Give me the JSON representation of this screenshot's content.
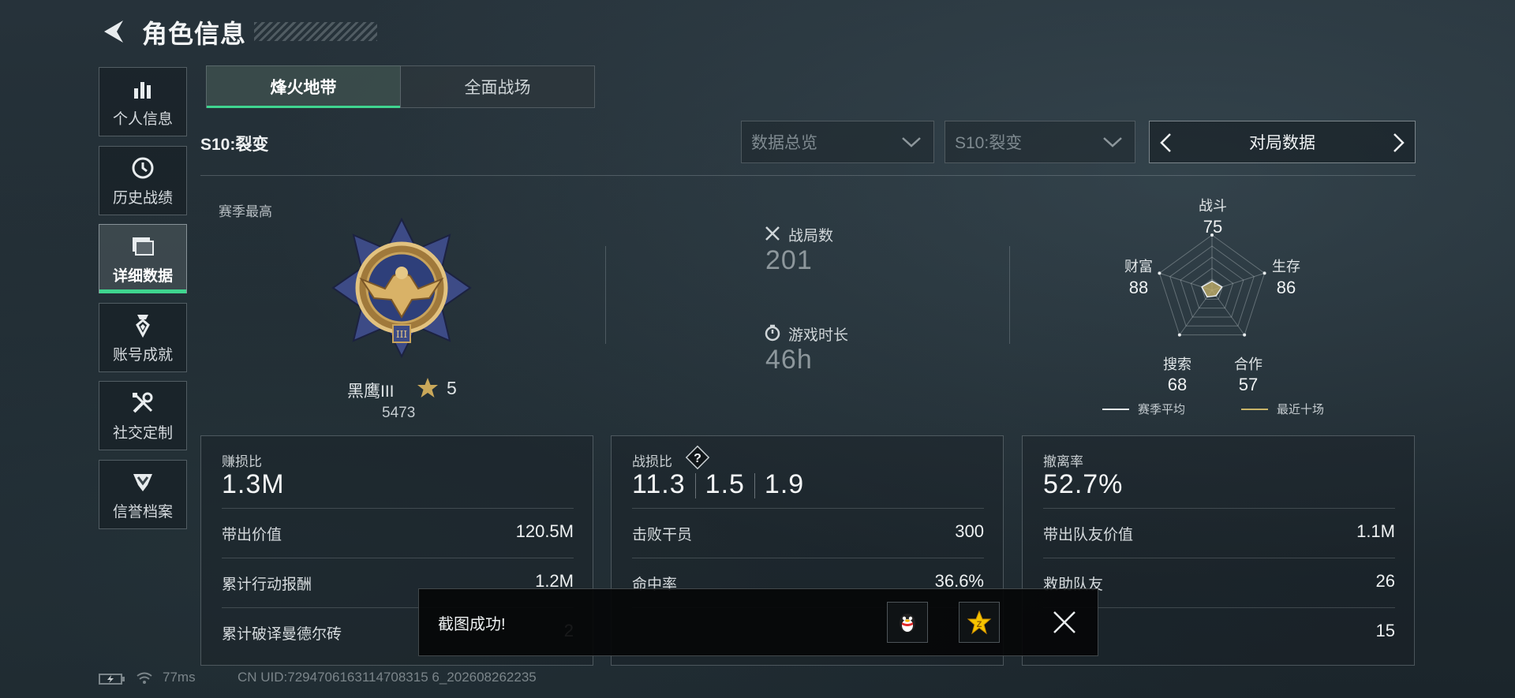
{
  "header": {
    "title": "角色信息"
  },
  "sidebar": {
    "items": [
      {
        "label": "个人信息",
        "icon": "bar-chart-icon",
        "active": false
      },
      {
        "label": "历史战绩",
        "icon": "clock-history-icon",
        "active": false
      },
      {
        "label": "详细数据",
        "icon": "folder-icon",
        "active": true
      },
      {
        "label": "账号成就",
        "icon": "medal-icon",
        "active": false
      },
      {
        "label": "社交定制",
        "icon": "tools-icon",
        "active": false
      },
      {
        "label": "信誉档案",
        "icon": "shield-badge-icon",
        "active": false
      }
    ]
  },
  "mode_tabs": [
    {
      "label": "烽火地带",
      "active": true
    },
    {
      "label": "全面战场",
      "active": false
    }
  ],
  "season_title": "S10:裂变",
  "filters": {
    "dropdown_1": "数据总览",
    "dropdown_2": "S10:裂变",
    "selector": "对局数据"
  },
  "rank": {
    "caption": "赛季最高",
    "name": "黑鹰III",
    "stars": "5",
    "score": "5473",
    "badge_icon": "eagle-medal-icon"
  },
  "summary": {
    "matches_label": "战局数",
    "matches_value": "201",
    "playtime_label": "游戏时长",
    "playtime_value": "46h"
  },
  "radar": {
    "axes": [
      {
        "label": "战斗",
        "value": "75"
      },
      {
        "label": "生存",
        "value": "86"
      },
      {
        "label": "合作",
        "value": "57"
      },
      {
        "label": "搜索",
        "value": "68"
      },
      {
        "label": "财富",
        "value": "88"
      }
    ],
    "legend_season": "赛季平均",
    "legend_recent": "最近十场",
    "colors": {
      "season": "#e8ecee",
      "recent": "#c9b469"
    }
  },
  "cards": {
    "profit": {
      "title": "赚损比",
      "value": "1.3M",
      "rows": [
        {
          "label": "带出价值",
          "value": "120.5M"
        },
        {
          "label": "累计行动报酬",
          "value": "1.2M"
        },
        {
          "label": "累计破译曼德尔砖",
          "value": "2"
        }
      ]
    },
    "combat": {
      "title": "战损比",
      "help_icon": "question-icon",
      "values": [
        "11.3",
        "1.5",
        "1.9"
      ],
      "rows": [
        {
          "label": "击败干员",
          "value": "300"
        },
        {
          "label": "命中率",
          "value": "36.6%"
        }
      ]
    },
    "extract": {
      "title": "撤离率",
      "value": "52.7%",
      "rows": [
        {
          "label": "带出队友价值",
          "value": "1.1M"
        },
        {
          "label": "救助队友",
          "value": "26"
        },
        {
          "label": "",
          "value": "15"
        }
      ]
    }
  },
  "toast": {
    "text": "截图成功!"
  },
  "status_bar": {
    "ping": "77ms",
    "uid": "CN UID:7294706163114708315 6_202608262235"
  },
  "accent_color": "#3fd58f"
}
